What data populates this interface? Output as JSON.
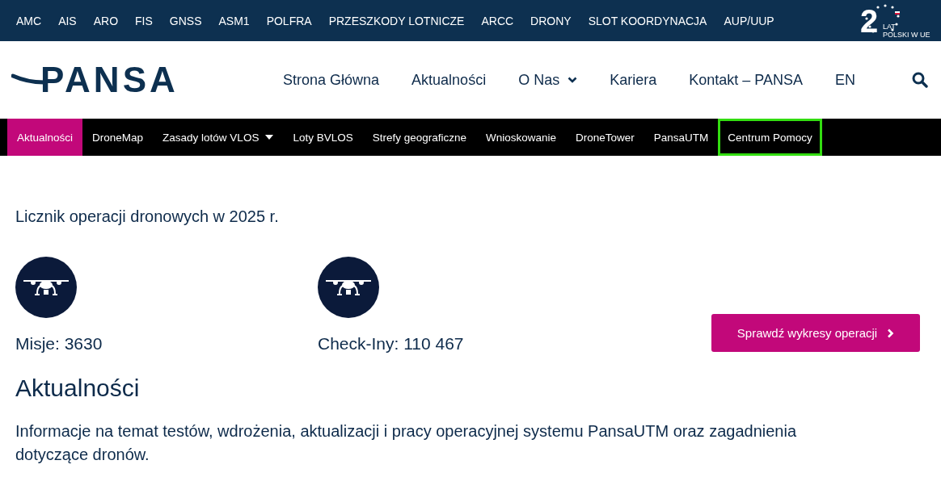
{
  "top_links": [
    "AMC",
    "AIS",
    "ARO",
    "FIS",
    "GNSS",
    "ASM1",
    "POLFRA",
    "PRZESZKODY LOTNICZE",
    "ARCC",
    "DRONY",
    "SLOT KOORDYNACJA",
    "AUP/UUP"
  ],
  "anniversary_badge": {
    "number": "2",
    "line_1": "LAT",
    "line_2": "POLSKI W UE"
  },
  "logo": {
    "text": "PANSA"
  },
  "main_nav": [
    {
      "label": "Strona Główna",
      "has_dropdown": false
    },
    {
      "label": "Aktualności",
      "has_dropdown": false
    },
    {
      "label": "O Nas",
      "has_dropdown": true
    },
    {
      "label": "Kariera",
      "has_dropdown": false
    },
    {
      "label": "Kontakt – PANSA",
      "has_dropdown": false
    },
    {
      "label": "EN",
      "has_dropdown": false
    }
  ],
  "sub_nav": [
    {
      "label": "Aktualności",
      "selected": true,
      "has_dropdown": false,
      "highlighted": false
    },
    {
      "label": "DroneMap",
      "selected": false,
      "has_dropdown": false,
      "highlighted": false
    },
    {
      "label": "Zasady lotów VLOS",
      "selected": false,
      "has_dropdown": true,
      "highlighted": false
    },
    {
      "label": "Loty BVLOS",
      "selected": false,
      "has_dropdown": false,
      "highlighted": false
    },
    {
      "label": "Strefy geograficzne",
      "selected": false,
      "has_dropdown": false,
      "highlighted": false
    },
    {
      "label": "Wnioskowanie",
      "selected": false,
      "has_dropdown": false,
      "highlighted": false
    },
    {
      "label": "DroneTower",
      "selected": false,
      "has_dropdown": false,
      "highlighted": false
    },
    {
      "label": "PansaUTM",
      "selected": false,
      "has_dropdown": false,
      "highlighted": false
    },
    {
      "label": "Centrum Pomocy",
      "selected": false,
      "has_dropdown": false,
      "highlighted": true
    }
  ],
  "counter_heading": "Licznik operacji dronowych w 2025 r.",
  "counters": [
    {
      "label": "Misje: 3630"
    },
    {
      "label": "Check-Iny: 110 467"
    }
  ],
  "chart_button": "Sprawdź wykresy operacji",
  "news": {
    "title": "Aktualności",
    "description": "Informacje na temat testów, wdrożenia, aktualizacji i pracy operacyjnej systemu PansaUTM oraz zagadnienia dotyczące dronów."
  }
}
